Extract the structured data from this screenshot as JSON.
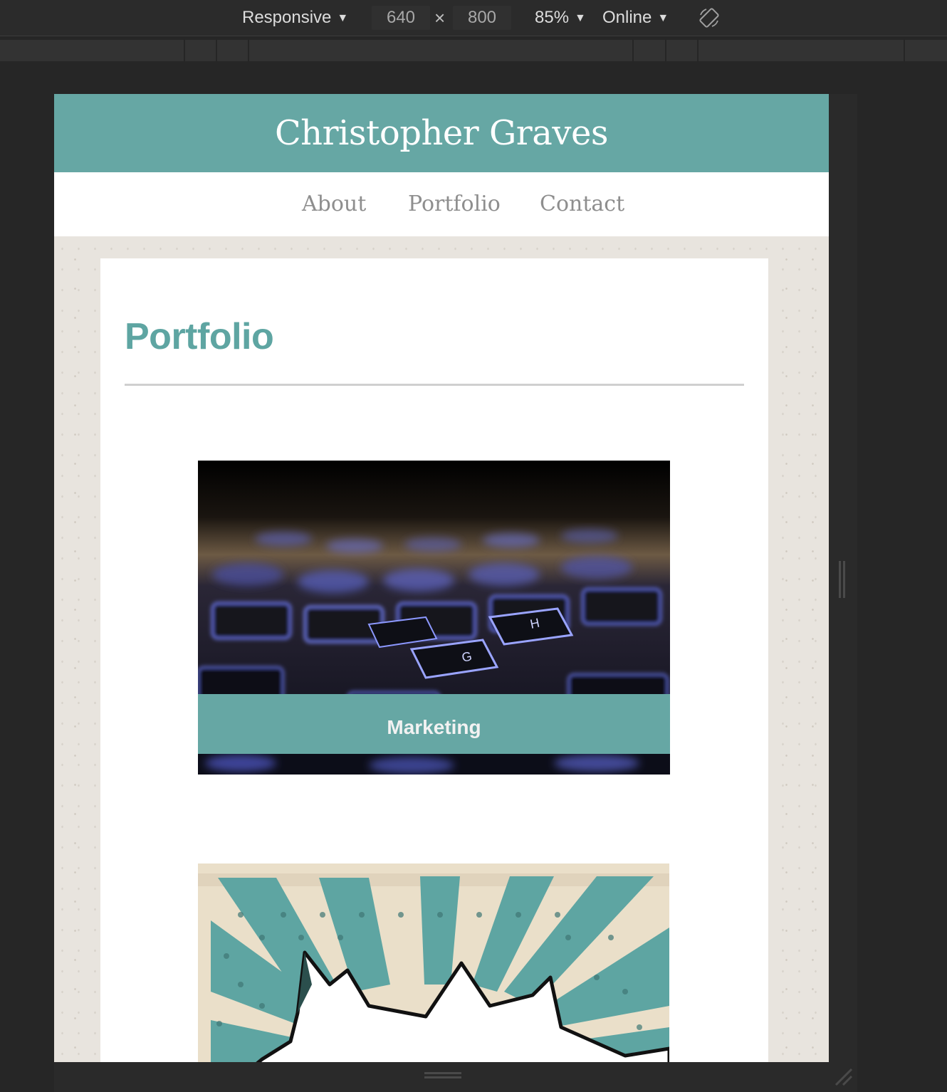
{
  "devtools": {
    "device_mode": "Responsive",
    "width": "640",
    "times": "×",
    "height": "800",
    "zoom": "85%",
    "network": "Online",
    "caret": "▼"
  },
  "site": {
    "title": "Christopher Graves",
    "nav": [
      {
        "label": "About"
      },
      {
        "label": "Portfolio"
      },
      {
        "label": "Contact"
      }
    ]
  },
  "page": {
    "heading": "Portfolio",
    "items": [
      {
        "caption": "Marketing",
        "image": "keyboard-photo"
      },
      {
        "caption": "",
        "image": "comic-burst-illustration"
      }
    ]
  },
  "colors": {
    "accent": "#66a7a4",
    "heading": "#5ea5a2",
    "nav_text": "#8e8e8e",
    "devtools_bg": "#2b2b2b"
  }
}
